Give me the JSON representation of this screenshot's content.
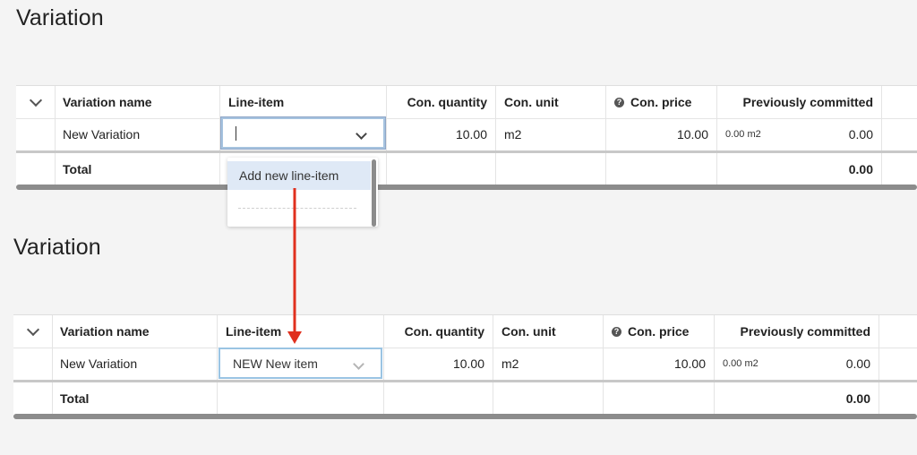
{
  "top": {
    "title": "Variation",
    "columns": {
      "expand": "",
      "variation_name": "Variation name",
      "line_item": "Line-item",
      "con_quantity": "Con. quantity",
      "con_unit": "Con. unit",
      "con_price": "Con. price",
      "previously_committed": "Previously committed"
    },
    "row": {
      "variation_name": "New Variation",
      "line_item_value": "",
      "con_quantity": "10.00",
      "con_unit": "m2",
      "con_price": "10.00",
      "prev_unit": "0.00 m2",
      "prev_value": "0.00"
    },
    "total": {
      "label": "Total",
      "value": "0.00"
    },
    "dropdown": {
      "option": "Add new line-item"
    }
  },
  "bottom": {
    "title": "Variation",
    "columns": {
      "variation_name": "Variation name",
      "line_item": "Line-item",
      "con_quantity": "Con. quantity",
      "con_unit": "Con. unit",
      "con_price": "Con. price",
      "previously_committed": "Previously committed"
    },
    "row": {
      "variation_name": "New Variation",
      "line_item_value": "NEW New item",
      "con_quantity": "10.00",
      "con_unit": "m2",
      "con_price": "10.00",
      "prev_unit": "0.00 m2",
      "prev_value": "0.00"
    },
    "total": {
      "label": "Total",
      "value": "0.00"
    }
  },
  "colors": {
    "arrow": "#e0301e",
    "focus_border": "#a6c3df",
    "option_highlight": "#dfe9f6",
    "background": "#f4f4f4"
  },
  "icons": {
    "expand": "chevron-down-icon",
    "help": "question-circle-icon",
    "select": "chevron-down-icon"
  }
}
